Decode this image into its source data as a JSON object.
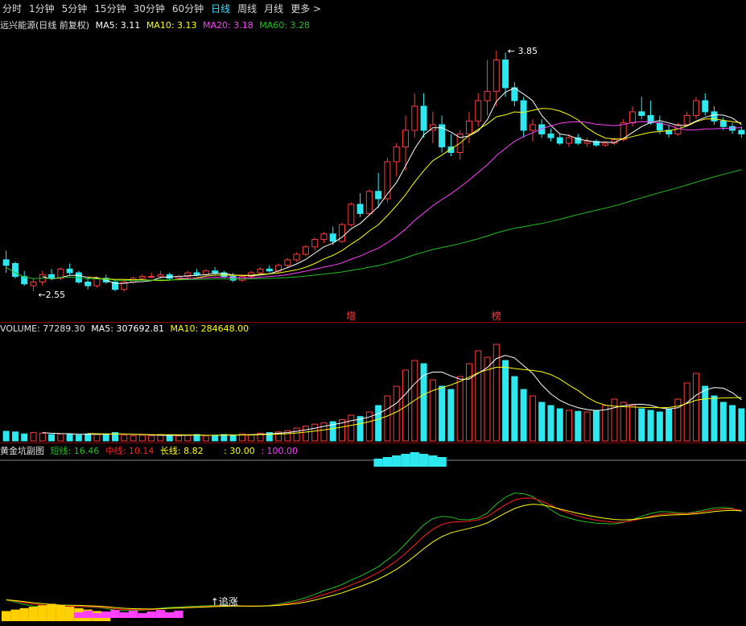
{
  "tabs": [
    {
      "label": "分时",
      "active": false
    },
    {
      "label": "1分钟",
      "active": false
    },
    {
      "label": "5分钟",
      "active": false
    },
    {
      "label": "15分钟",
      "active": false
    },
    {
      "label": "30分钟",
      "active": false
    },
    {
      "label": "60分钟",
      "active": false
    },
    {
      "label": "日线",
      "active": true
    },
    {
      "label": "周线",
      "active": false
    },
    {
      "label": "月线",
      "active": false
    },
    {
      "label": "更多 >",
      "active": false
    }
  ],
  "main_info": {
    "title": "远兴能源(日线 前复权)",
    "ma5": "MA5: 3.11",
    "ma10": "MA10: 3.13",
    "ma20": "MA20: 3.18",
    "ma60": "MA60: 3.28"
  },
  "vol_info": {
    "volume": "VOLUME: 77289.30",
    "ma5": "MA5: 307692.81",
    "ma10": "MA10: 284648.00"
  },
  "ind_info": {
    "name": "黄金坑副图",
    "short": "短线: 16.46",
    "mid": "中线: 10.14",
    "long": "长线: 8.82",
    "level1": ": 30.00",
    "level2": ": 100.00"
  },
  "markers": {
    "high": "3.85",
    "low": "2.55",
    "tag1": "增",
    "tag2": "榜",
    "signal": "追涨"
  },
  "colors": {
    "up": "#ff3a3a",
    "down": "#2ee8f0",
    "ma5": "#ffffff",
    "ma10": "#ffff00",
    "ma20": "#ff40ff",
    "ma60": "#20c020",
    "short": "#20c020",
    "mid": "#ff2020",
    "long": "#ffff00",
    "tab_active": "#3ce0ff"
  },
  "chart_data": {
    "type": "candlestick",
    "price_range": [
      2.45,
      3.95
    ],
    "candles": [
      [
        2.72,
        2.77,
        2.65,
        2.69
      ],
      [
        2.7,
        2.71,
        2.62,
        2.63
      ],
      [
        2.63,
        2.66,
        2.58,
        2.59
      ],
      [
        2.58,
        2.62,
        2.55,
        2.6
      ],
      [
        2.6,
        2.66,
        2.58,
        2.64
      ],
      [
        2.64,
        2.67,
        2.61,
        2.62
      ],
      [
        2.62,
        2.68,
        2.61,
        2.67
      ],
      [
        2.67,
        2.7,
        2.64,
        2.65
      ],
      [
        2.65,
        2.66,
        2.59,
        2.6
      ],
      [
        2.6,
        2.62,
        2.56,
        2.58
      ],
      [
        2.58,
        2.63,
        2.57,
        2.62
      ],
      [
        2.62,
        2.64,
        2.59,
        2.6
      ],
      [
        2.6,
        2.61,
        2.55,
        2.56
      ],
      [
        2.56,
        2.61,
        2.55,
        2.6
      ],
      [
        2.6,
        2.63,
        2.59,
        2.62
      ],
      [
        2.62,
        2.64,
        2.61,
        2.63
      ],
      [
        2.63,
        2.65,
        2.62,
        2.63
      ],
      [
        2.63,
        2.66,
        2.62,
        2.64
      ],
      [
        2.64,
        2.65,
        2.61,
        2.62
      ],
      [
        2.62,
        2.64,
        2.61,
        2.63
      ],
      [
        2.63,
        2.66,
        2.62,
        2.65
      ],
      [
        2.65,
        2.67,
        2.63,
        2.64
      ],
      [
        2.64,
        2.67,
        2.63,
        2.66
      ],
      [
        2.66,
        2.68,
        2.64,
        2.65
      ],
      [
        2.65,
        2.66,
        2.62,
        2.63
      ],
      [
        2.63,
        2.65,
        2.6,
        2.61
      ],
      [
        2.61,
        2.64,
        2.6,
        2.63
      ],
      [
        2.63,
        2.66,
        2.62,
        2.65
      ],
      [
        2.65,
        2.68,
        2.64,
        2.67
      ],
      [
        2.67,
        2.69,
        2.65,
        2.66
      ],
      [
        2.66,
        2.7,
        2.65,
        2.69
      ],
      [
        2.69,
        2.73,
        2.68,
        2.72
      ],
      [
        2.72,
        2.76,
        2.71,
        2.75
      ],
      [
        2.75,
        2.8,
        2.74,
        2.79
      ],
      [
        2.79,
        2.84,
        2.77,
        2.83
      ],
      [
        2.83,
        2.87,
        2.81,
        2.86
      ],
      [
        2.86,
        2.9,
        2.8,
        2.82
      ],
      [
        2.82,
        2.92,
        2.81,
        2.91
      ],
      [
        2.91,
        3.03,
        2.9,
        3.02
      ],
      [
        3.02,
        3.08,
        2.95,
        2.97
      ],
      [
        2.97,
        3.1,
        2.96,
        3.09
      ],
      [
        3.09,
        3.19,
        3.0,
        3.05
      ],
      [
        3.05,
        3.27,
        3.03,
        3.25
      ],
      [
        3.25,
        3.35,
        3.17,
        3.33
      ],
      [
        3.33,
        3.5,
        3.2,
        3.42
      ],
      [
        3.42,
        3.62,
        3.38,
        3.55
      ],
      [
        3.55,
        3.62,
        3.38,
        3.42
      ],
      [
        3.42,
        3.52,
        3.35,
        3.45
      ],
      [
        3.45,
        3.5,
        3.3,
        3.33
      ],
      [
        3.33,
        3.4,
        3.28,
        3.3
      ],
      [
        3.3,
        3.42,
        3.26,
        3.4
      ],
      [
        3.4,
        3.52,
        3.35,
        3.47
      ],
      [
        3.47,
        3.62,
        3.44,
        3.58
      ],
      [
        3.58,
        3.8,
        3.5,
        3.63
      ],
      [
        3.63,
        3.85,
        3.55,
        3.8
      ],
      [
        3.8,
        3.84,
        3.6,
        3.65
      ],
      [
        3.65,
        3.68,
        3.55,
        3.58
      ],
      [
        3.58,
        3.6,
        3.38,
        3.42
      ],
      [
        3.42,
        3.48,
        3.36,
        3.45
      ],
      [
        3.45,
        3.48,
        3.38,
        3.4
      ],
      [
        3.4,
        3.43,
        3.36,
        3.38
      ],
      [
        3.38,
        3.4,
        3.34,
        3.35
      ],
      [
        3.35,
        3.4,
        3.33,
        3.38
      ],
      [
        3.38,
        3.4,
        3.34,
        3.35
      ],
      [
        3.35,
        3.38,
        3.33,
        3.36
      ],
      [
        3.36,
        3.37,
        3.33,
        3.34
      ],
      [
        3.34,
        3.36,
        3.33,
        3.35
      ],
      [
        3.35,
        3.38,
        3.34,
        3.37
      ],
      [
        3.37,
        3.48,
        3.36,
        3.46
      ],
      [
        3.46,
        3.55,
        3.44,
        3.52
      ],
      [
        3.52,
        3.6,
        3.48,
        3.5
      ],
      [
        3.5,
        3.58,
        3.45,
        3.46
      ],
      [
        3.46,
        3.5,
        3.4,
        3.42
      ],
      [
        3.42,
        3.45,
        3.38,
        3.4
      ],
      [
        3.4,
        3.46,
        3.39,
        3.45
      ],
      [
        3.45,
        3.52,
        3.44,
        3.5
      ],
      [
        3.5,
        3.6,
        3.48,
        3.58
      ],
      [
        3.58,
        3.62,
        3.5,
        3.52
      ],
      [
        3.52,
        3.55,
        3.45,
        3.47
      ],
      [
        3.47,
        3.49,
        3.42,
        3.44
      ],
      [
        3.44,
        3.46,
        3.4,
        3.42
      ],
      [
        3.42,
        3.44,
        3.38,
        3.4
      ]
    ],
    "volumes": [
      30,
      28,
      22,
      26,
      24,
      20,
      22,
      20,
      18,
      22,
      20,
      22,
      26,
      18,
      16,
      18,
      16,
      20,
      18,
      16,
      18,
      20,
      16,
      18,
      20,
      18,
      22,
      20,
      24,
      26,
      28,
      32,
      40,
      46,
      52,
      56,
      60,
      66,
      80,
      76,
      90,
      110,
      140,
      170,
      220,
      250,
      240,
      190,
      170,
      160,
      200,
      240,
      280,
      260,
      300,
      250,
      200,
      160,
      140,
      120,
      110,
      100,
      95,
      92,
      90,
      95,
      110,
      130,
      120,
      110,
      100,
      95,
      90,
      100,
      130,
      180,
      210,
      170,
      140,
      120,
      110,
      100
    ],
    "volume_max": 320,
    "indicator": {
      "range": [
        0,
        100
      ],
      "levels": [
        30,
        100
      ]
    }
  }
}
